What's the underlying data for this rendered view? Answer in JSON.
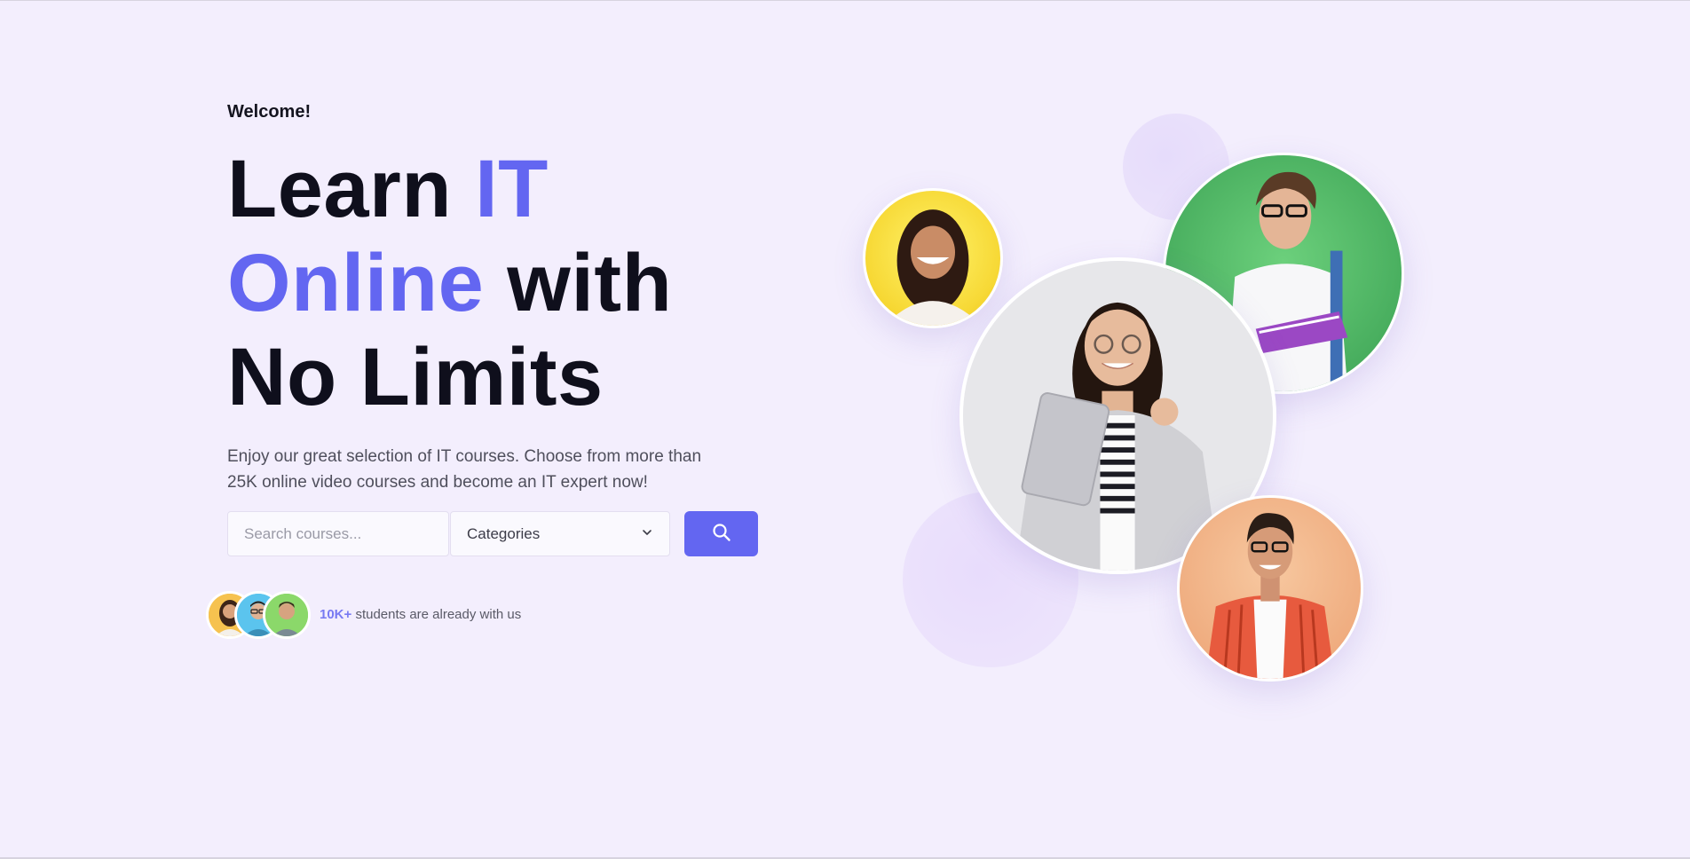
{
  "hero": {
    "welcome": "Welcome!",
    "headline": {
      "part1": "Learn ",
      "part2": "IT",
      "part3": "Online",
      "part4": " with",
      "part5": "No Limits"
    },
    "description": "Enjoy our great selection of IT courses. Choose from more than 25K online video courses and become an IT expert now!"
  },
  "search": {
    "placeholder": "Search courses...",
    "category_selected": "Categories",
    "button_icon": "search-icon"
  },
  "social_proof": {
    "count": "10K+",
    "text": " students are already with us"
  },
  "colors": {
    "accent": "#6366f1",
    "background": "#f3eefd",
    "heading": "#0f0f1c"
  }
}
